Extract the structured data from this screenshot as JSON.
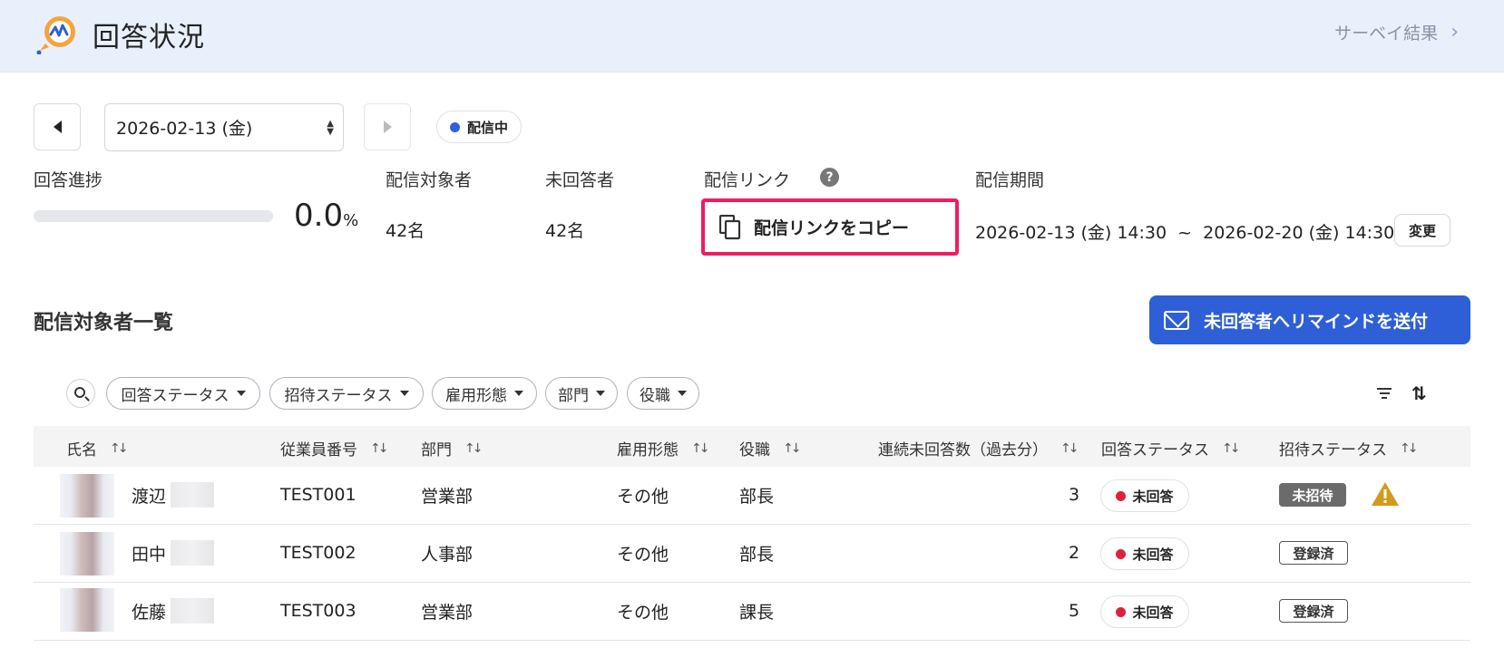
{
  "header": {
    "title": "回答状況",
    "survey_link": "サーベイ結果",
    "brand_color": "#f7a33c"
  },
  "controls": {
    "date": "2026-02-13 (金)",
    "status": "配信中"
  },
  "stats": {
    "progress_label": "回答進捗",
    "progress_value": "0.0",
    "progress_unit": "%",
    "progress_fraction": 0.0,
    "targets_label": "配信対象者",
    "targets_value": "42名",
    "unanswered_label": "未回答者",
    "unanswered_value": "42名",
    "link_label": "配信リンク",
    "help": "?",
    "copy_label": "配信リンクをコピー",
    "period_label": "配信期間",
    "period_value": "2026-02-13 (金) 14:30  ~  2026-02-20 (金) 14:30",
    "change_label": "変更"
  },
  "list": {
    "title": "配信対象者一覧",
    "remind_label": "未回答者へリマインドを送付",
    "filters": [
      "回答ステータス",
      "招待ステータス",
      "雇用形態",
      "部門",
      "役職"
    ],
    "columns": [
      "氏名",
      "従業員番号",
      "部門",
      "雇用形態",
      "役職",
      "連続未回答数（過去分）",
      "回答ステータス",
      "招待ステータス"
    ],
    "rows": [
      {
        "name": "渡辺",
        "id": "TEST001",
        "dept": "営業部",
        "employment": "その他",
        "position": "部長",
        "streak": "3",
        "response": "未回答",
        "invite": "未招待",
        "warning": true
      },
      {
        "name": "田中",
        "id": "TEST002",
        "dept": "人事部",
        "employment": "その他",
        "position": "部長",
        "streak": "2",
        "response": "未回答",
        "invite": "登録済",
        "warning": false
      },
      {
        "name": "佐藤",
        "id": "TEST003",
        "dept": "営業部",
        "employment": "その他",
        "position": "課長",
        "streak": "5",
        "response": "未回答",
        "invite": "登録済",
        "warning": false
      }
    ]
  },
  "colors": {
    "accent": "#2e5fd6",
    "highlight_border": "#ee1d63",
    "unanswered_dot": "#e0203a",
    "warning": "#d39b1c"
  }
}
